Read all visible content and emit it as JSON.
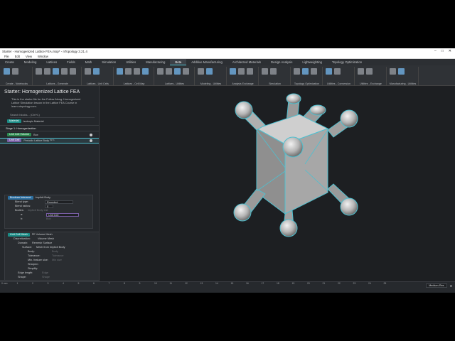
{
  "window": {
    "title": "Starter - Homogenized Lattice FEA.ntop* - nTopology 3.21.4",
    "controls": [
      "–",
      "□",
      "✕"
    ]
  },
  "menu": [
    "File",
    "Edit",
    "View",
    "Window"
  ],
  "tabs": [
    {
      "label": "Create"
    },
    {
      "label": "Modeling"
    },
    {
      "label": "Lattices"
    },
    {
      "label": "Fields"
    },
    {
      "label": "Math"
    },
    {
      "label": "Simulation"
    },
    {
      "label": "Utilities"
    },
    {
      "label": "Manufacturing"
    },
    {
      "label": "Beta",
      "active": true
    },
    {
      "label": "Additive Manufacturing"
    },
    {
      "label": "Architected Materials"
    },
    {
      "label": "Design Analysis"
    },
    {
      "label": "Lightweighting"
    },
    {
      "label": "Topology Optimization"
    }
  ],
  "ribbon_groups": [
    {
      "label": "Create - Notebooks",
      "icons": 2
    },
    {
      "label": "Lattices - Generate",
      "icons": 5
    },
    {
      "label": "Lattices - Unit Cells",
      "icons": 2
    },
    {
      "label": "Lattices - Cell Map",
      "icons": 4
    },
    {
      "label": "Lattices - Utilities",
      "icons": 4
    },
    {
      "label": "Modeling - Utilities",
      "icons": 2
    },
    {
      "label": "Analysis Exchange",
      "icons": 3
    },
    {
      "label": "Simulation",
      "icons": 2
    },
    {
      "label": "Topology Optimization",
      "icons": 3
    },
    {
      "label": "Utilities - Conversion",
      "icons": 2
    },
    {
      "label": "Utilities - Exchange",
      "icons": 2
    },
    {
      "label": "Manufacturing - Utilities",
      "icons": 2
    }
  ],
  "notebook": {
    "title": "Starter: Homogenized Lattice FEA",
    "description": "This is the starter file for the Follow Along: Homogenized Lattice Simulation lesson in the Lattice FEA Course in learn.ntopology.com.",
    "search_placeholder": "Search blocks... (Ctrl+L)",
    "material": {
      "chip": "Material",
      "value": "Isotropic Material"
    },
    "stage_label": "Stage 1: Homogenization",
    "unit_cell_volume": {
      "chip": "Unit Cell Volume",
      "value": "Box"
    },
    "unit_cell": {
      "chip": "Unit Cell",
      "value": "Periodic Lattice Body",
      "badge": "BETA"
    },
    "boolean": {
      "chip": "Boolean Intersect",
      "value": "Implicit Body",
      "blend_type_label": "Blend type:",
      "blend_type": "Rounded",
      "blend_radius_label": "Blend radius:",
      "blend_radius": "0",
      "bodies_label": "Bodies:",
      "bodies_value": "Implicit Body List",
      "item_a_label": "a:",
      "item_a": "Unit Cell",
      "item_b_label": "b:",
      "item_b": "Box"
    },
    "mesh": {
      "chip": "Unit Cell Mesh",
      "value": "FE Volume Mesh",
      "discretization_label": "Discretization:",
      "discretization": "Volume Mesh",
      "domain_label": "Domain:",
      "domain": "Remesh Surface",
      "surface_label": "Surface:",
      "surface": "Mesh from Implicit Body",
      "body_label": "Body:",
      "body": "Body",
      "tolerance_label": "Tolerance:",
      "tolerance": "Tolerance",
      "min_feature_label": "Min. feature size:",
      "min_feature": "Min size",
      "sharpen_label": "Sharpen:",
      "simplify_label": "Simplify:",
      "edge_length_label": "Edge length:",
      "edge_length": "Edge",
      "shape_label": "Shape:",
      "shape": "Shape",
      "span_angle_label": "Span angle:",
      "span_angle": "30",
      "growth_rate_label": "Growth rate:",
      "growth_rate": "2",
      "feature_angle_label": "Feature angle:",
      "feature_angle": "45"
    },
    "output_label": "Output:"
  },
  "ruler_ticks": [
    "0 mm",
    "1",
    "2",
    "3",
    "4",
    "5",
    "6",
    "7",
    "8",
    "9",
    "10",
    "11",
    "12",
    "13",
    "14",
    "15",
    "16",
    "17",
    "18",
    "19",
    "20",
    "21",
    "22",
    "23",
    "24",
    "25"
  ],
  "status": {
    "quality": "Medium-Res"
  },
  "colors": {
    "accent": "#4fc0d0",
    "panel": "#24272b",
    "viewport": "#1d1f22",
    "part": "#a9a9a9"
  }
}
